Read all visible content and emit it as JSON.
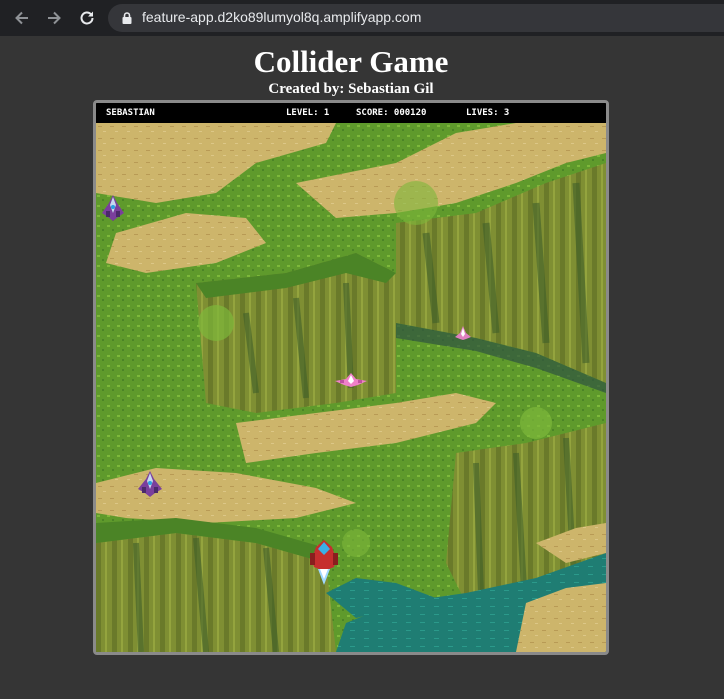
{
  "browser": {
    "url": "feature-app.d2ko89lumyol8q.amplifyapp.com",
    "icons": [
      "back-arrow-icon",
      "forward-arrow-icon",
      "reload-icon",
      "lock-icon"
    ]
  },
  "page": {
    "title": "Collider Game",
    "subtitle": "Created by: Sebastian Gil"
  },
  "hud": {
    "player": "SEBASTIAN",
    "level": "LEVEL: 1",
    "score": "SCORE: 000120",
    "lives": "LIVES: 3"
  },
  "game": {
    "player_ship": "red-fighter-ship",
    "enemies": [
      "purple-enemy-ship",
      "pink-enemy-ship",
      "pink-winged-enemy-ship",
      "purple-enemy-ship"
    ],
    "colors": {
      "grass": "#5f9a2c",
      "sand": "#cdb56b",
      "cliff": "#7f8f33",
      "water": "#1f7d73",
      "background": "#353535"
    }
  }
}
